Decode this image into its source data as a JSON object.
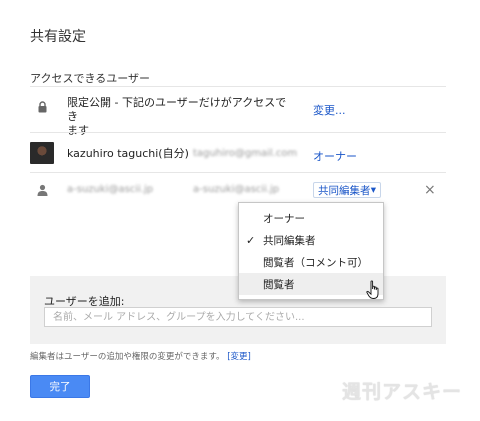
{
  "dialog": {
    "title": "共有設定",
    "section_label": "アクセスできるユーザー"
  },
  "rows": [
    {
      "icon": "lock-icon",
      "text": "限定公開 - 下記のユーザーだけがアクセスできます",
      "text_line1": "限定公開 - 下記のユーザーだけがアクセスでき",
      "text_line2": "ます",
      "action": "変更..."
    },
    {
      "icon": "avatar",
      "name": "kazuhiro taguchi(自分)",
      "email": "taguhiro@gmail.com",
      "role": "オーナー"
    },
    {
      "icon": "person-icon",
      "name": "a-suzuki@ascii.jp",
      "email": "a-suzuki@ascii.jp",
      "role": "共同編集者"
    }
  ],
  "role_menu": {
    "options": [
      "オーナー",
      "共同編集者",
      "閲覧者（コメント可）",
      "閲覧者"
    ],
    "checked": "共同編集者",
    "hovered": "閲覧者"
  },
  "add_user": {
    "label": "ユーザーを追加:",
    "placeholder": "名前、メール アドレス、グループを入力してください..."
  },
  "footnote": {
    "text": "編集者はユーザーの追加や権限の変更ができます。",
    "link": "[変更]"
  },
  "done_button": "完了",
  "watermark": "週刊アスキー",
  "icons": {
    "close": "×",
    "check": "✓",
    "caret": "▾"
  }
}
